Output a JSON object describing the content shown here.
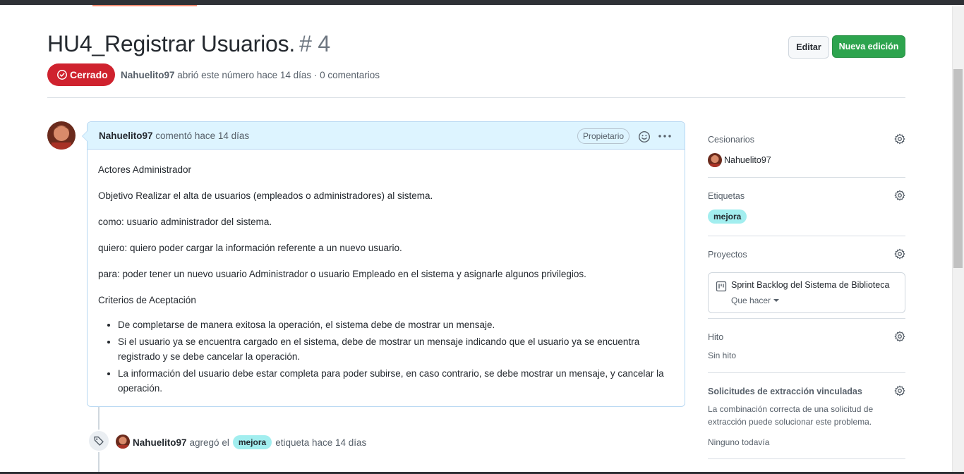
{
  "issue": {
    "title": "HU4_Registrar Usuarios.",
    "number": "# 4",
    "state": "Cerrado",
    "author": "Nahuelito97",
    "meta_text": "abrió este número hace 14 días · 0 comentarios"
  },
  "actions": {
    "edit_label": "Editar",
    "new_label": "Nueva edición"
  },
  "comment": {
    "author": "Nahuelito97",
    "time_text": "comentó hace 14 días",
    "owner_badge": "Propietario",
    "paragraphs": [
      "Actores Administrador",
      "Objetivo Realizar el alta de usuarios (empleados o administradores) al sistema.",
      "como: usuario administrador del sistema.",
      "quiero: quiero poder cargar la información referente a un nuevo usuario.",
      "para: poder tener un nuevo usuario Administrador o usuario Empleado en el sistema y asignarle algunos privilegios.",
      "Criterios de Aceptación"
    ],
    "criteria": [
      "De completarse de manera exitosa la operación, el sistema debe de mostrar un mensaje.",
      "Si el usuario ya se encuentra cargado en el sistema, debe de mostrar un mensaje indicando que el usuario ya se encuentra registrado y se debe cancelar la operación.",
      "La información del usuario debe estar completa para poder subirse, en caso contrario, se debe mostrar un mensaje, y cancelar la operación."
    ]
  },
  "event": {
    "author": "Nahuelito97",
    "action": "agregó el",
    "label": "mejora",
    "suffix": "etiqueta hace 14 días"
  },
  "sidebar": {
    "assignees_title": "Cesionarios",
    "assignee": "Nahuelito97",
    "labels_title": "Etiquetas",
    "label": "mejora",
    "projects_title": "Proyectos",
    "project_name": "Sprint Backlog del Sistema de Biblioteca",
    "project_status": "Que hacer",
    "milestone_title": "Hito",
    "milestone_value": "Sin hito",
    "linked_title": "Solicitudes de extracción vinculadas",
    "linked_desc": "La combinación correcta de una solicitud de extracción puede solucionar este problema.",
    "linked_value": "Ninguno todavía"
  },
  "colors": {
    "closed_red": "#cf222e",
    "primary_green": "#2da44e",
    "label_bg": "#a2eeef",
    "header_blue": "#ddf4ff"
  }
}
